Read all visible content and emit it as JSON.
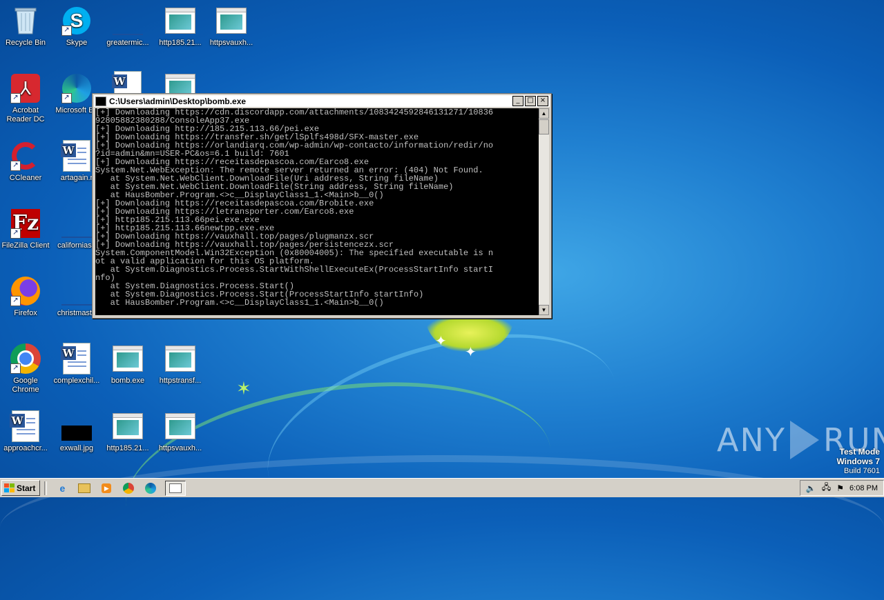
{
  "desktop": {
    "icons": [
      {
        "label": "Recycle Bin"
      },
      {
        "label": "Skype"
      },
      {
        "label": "greatermic..."
      },
      {
        "label": "http185.21..."
      },
      {
        "label": "httpsvauxh..."
      },
      {
        "label": "Acrobat Reader DC"
      },
      {
        "label": "Microsoft Ed"
      },
      {
        "label": "CCleaner"
      },
      {
        "label": "artagain.r"
      },
      {
        "label": "FileZilla Client"
      },
      {
        "label": "californiaso"
      },
      {
        "label": "Firefox"
      },
      {
        "label": "christmasth"
      },
      {
        "label": "Google Chrome"
      },
      {
        "label": "complexchil..."
      },
      {
        "label": "bomb.exe"
      },
      {
        "label": "httpstransf..."
      },
      {
        "label": "approachcr..."
      },
      {
        "label": "exwall.jpg"
      },
      {
        "label": "http185.21..."
      },
      {
        "label": "httpsvauxh..."
      }
    ]
  },
  "console_window": {
    "title": "C:\\Users\\admin\\Desktop\\bomb.exe",
    "minimize": "_",
    "maximize": "□",
    "close": "×",
    "output": "[+] Downloading https://cdn.discordapp.com/attachments/1083424592846131271/10836\n92805882380288/ConsoleApp37.exe\n[+] Downloading http://185.215.113.66/pei.exe\n[+] Downloading https://transfer.sh/get/lSplfs498d/SFX-master.exe\n[+] Downloading https://orlandiarq.com/wp-admin/wp-contacto/information/redir/no\n?id=admin&mn=USER-PC&os=6.1 build: 7601\n[+] Downloading https://receitasdepascoa.com/Earco8.exe\nSystem.Net.WebException: The remote server returned an error: (404) Not Found.\n   at System.Net.WebClient.DownloadFile(Uri address, String fileName)\n   at System.Net.WebClient.DownloadFile(String address, String fileName)\n   at HausBomber.Program.<>c__DisplayClass1_1.<Main>b__0()\n[+] Downloading https://receitasdepascoa.com/Brobite.exe\n[+] Downloading https://letransporter.com/Earco8.exe\n[+] http185.215.113.66pei.exe.exe\n[+] http185.215.113.66newtpp.exe.exe\n[+] Downloading https://vauxhall.top/pages/plugmanzx.scr\n[+] Downloading https://vauxhall.top/pages/persistencezx.scr\nSystem.ComponentModel.Win32Exception (0x80004005): The specified executable is n\not a valid application for this OS platform.\n   at System.Diagnostics.Process.StartWithShellExecuteEx(ProcessStartInfo startI\nnfo)\n   at System.Diagnostics.Process.Start()\n   at System.Diagnostics.Process.Start(ProcessStartInfo startInfo)\n   at HausBomber.Program.<>c__DisplayClass1_1.<Main>b__0()"
  },
  "watermark": {
    "left": "ANY",
    "right": "RUN"
  },
  "test_mode": {
    "line1": "Test Mode",
    "line2": "Windows 7",
    "line3": "Build 7601"
  },
  "taskbar": {
    "start_label": "Start",
    "clock": "6:08 PM"
  },
  "colors": {
    "desktop_bg": "#1f7fd0",
    "console_bg": "#000000",
    "console_text": "#c0c0c0",
    "taskbar": "#d4d0c8"
  }
}
